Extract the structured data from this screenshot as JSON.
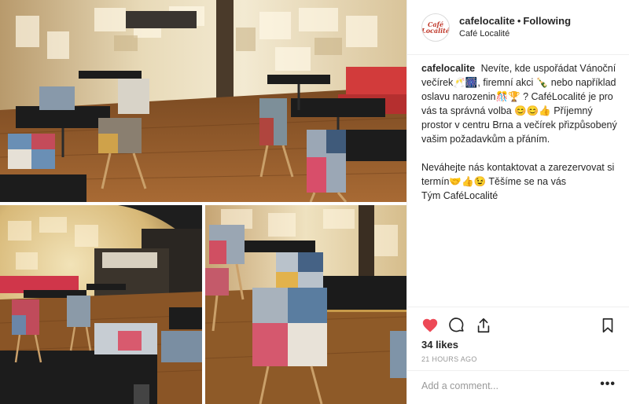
{
  "post": {
    "username": "cafelocalite",
    "separator": "•",
    "follow_label": "Following",
    "location": "Café Localité",
    "avatar_text": "Café Localité",
    "caption": "Nevíte, kde uspořádat Vánoční večírek🥂🎆, firemní akci 🍾 nebo například oslavu narozenin🎊🏆 ? CaféLocalité je pro vás ta správná volba 😊😊👍 Příjemný prostor v centru Brna a večírek přizpůsobený vašim požadavkům a přáním.\n\nNeváhejte nás kontaktovat a zarezervovat si termín🤝👍😉 Těšíme se na vás\nTým CaféLocalité",
    "likes": "34 likes",
    "time": "21 HOURS AGO",
    "comment_placeholder": "Add a comment...",
    "more_label": "•••"
  },
  "icons": {
    "heart": "heart-icon",
    "comment": "comment-icon",
    "share": "share-icon",
    "save": "bookmark-icon"
  },
  "colors": {
    "heart_red": "#ed4956",
    "text": "#262626",
    "muted": "#999999",
    "border": "#efefef"
  }
}
